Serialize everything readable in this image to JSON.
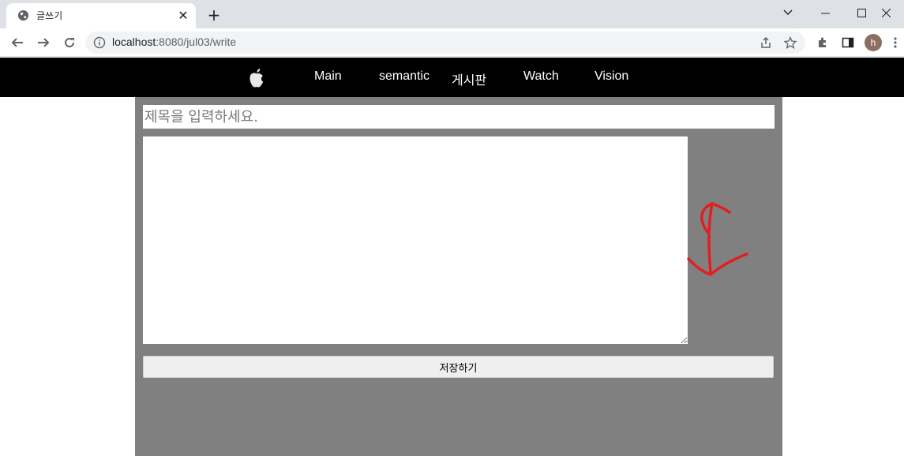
{
  "browser": {
    "tab_title": "글쓰기",
    "tab_close": "✕",
    "new_tab": "+",
    "url_host": "localhost",
    "url_rest": ":8080/jul03/write",
    "avatar_initial": "h",
    "icons": [
      "globe-icon",
      "back-icon",
      "forward-icon",
      "reload-icon",
      "info-icon",
      "share-icon",
      "star-icon",
      "extensions-icon",
      "sidepanel-icon",
      "menu-icon",
      "minimize-icon",
      "maximize-icon",
      "close-window-icon",
      "tab-search-icon"
    ]
  },
  "nav": {
    "logo_icon": "apple-icon",
    "items": [
      "Main",
      "semantic",
      "게시판",
      "Watch",
      "Vision"
    ]
  },
  "form": {
    "title_placeholder": "제목을 입력하세요.",
    "title_value": "",
    "body_value": "",
    "save_label": "저장하기"
  },
  "colors": {
    "navbar_bg": "#000000",
    "content_bg": "#808080",
    "annotation": "#e02020"
  }
}
